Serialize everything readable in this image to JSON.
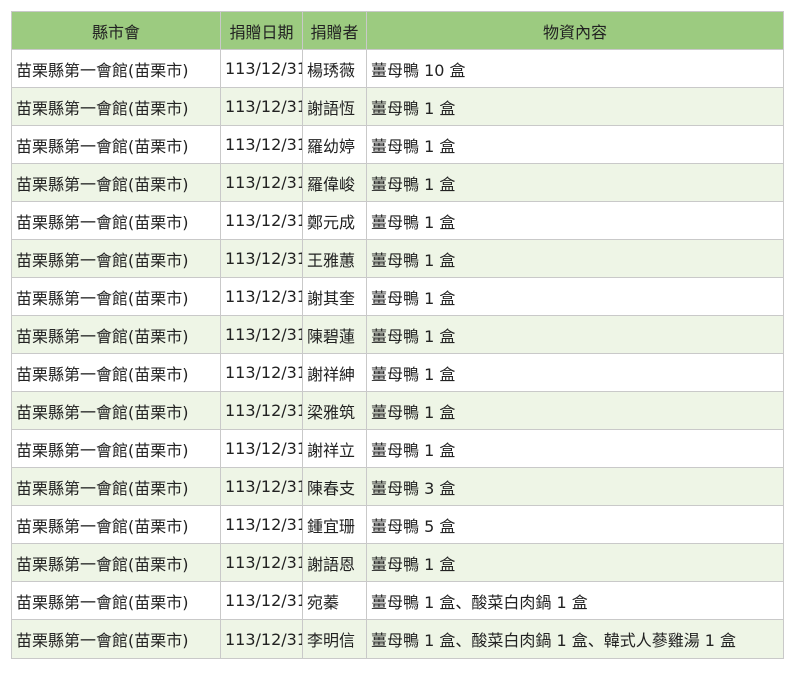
{
  "table": {
    "headers": [
      "縣市會",
      "捐贈日期",
      "捐贈者",
      "物資內容"
    ],
    "rows": [
      [
        "苗栗縣第一會館(苗栗市)",
        "113/12/31",
        "楊琇薇",
        "薑母鴨 10 盒"
      ],
      [
        "苗栗縣第一會館(苗栗市)",
        "113/12/31",
        "謝語恆",
        "薑母鴨 1 盒"
      ],
      [
        "苗栗縣第一會館(苗栗市)",
        "113/12/31",
        "羅幼婷",
        "薑母鴨 1 盒"
      ],
      [
        "苗栗縣第一會館(苗栗市)",
        "113/12/31",
        "羅偉峻",
        "薑母鴨 1 盒"
      ],
      [
        "苗栗縣第一會館(苗栗市)",
        "113/12/31",
        "鄭元成",
        "薑母鴨 1 盒"
      ],
      [
        "苗栗縣第一會館(苗栗市)",
        "113/12/31",
        "王雅蕙",
        "薑母鴨 1 盒"
      ],
      [
        "苗栗縣第一會館(苗栗市)",
        "113/12/31",
        "謝其奎",
        "薑母鴨 1 盒"
      ],
      [
        "苗栗縣第一會館(苗栗市)",
        "113/12/31",
        "陳碧蓮",
        "薑母鴨 1 盒"
      ],
      [
        "苗栗縣第一會館(苗栗市)",
        "113/12/31",
        "謝祥紳",
        "薑母鴨 1 盒"
      ],
      [
        "苗栗縣第一會館(苗栗市)",
        "113/12/31",
        "梁雅筑",
        "薑母鴨 1 盒"
      ],
      [
        "苗栗縣第一會館(苗栗市)",
        "113/12/31",
        "謝祥立",
        "薑母鴨 1 盒"
      ],
      [
        "苗栗縣第一會館(苗栗市)",
        "113/12/31",
        "陳春支",
        "薑母鴨 3 盒"
      ],
      [
        "苗栗縣第一會館(苗栗市)",
        "113/12/31",
        "鍾宜珊",
        "薑母鴨 5 盒"
      ],
      [
        "苗栗縣第一會館(苗栗市)",
        "113/12/31",
        "謝語恩",
        "薑母鴨 1 盒"
      ],
      [
        "苗栗縣第一會館(苗栗市)",
        "113/12/31",
        "宛蓁",
        "薑母鴨 1 盒、酸菜白肉鍋 1 盒"
      ],
      [
        "苗栗縣第一會館(苗栗市)",
        "113/12/31",
        "李明信",
        "薑母鴨 1 盒、酸菜白肉鍋 1 盒、韓式人蔘雞湯 1 盒"
      ]
    ]
  },
  "colors": {
    "header_bg": "#9ccb80",
    "row_alt_bg": "#eef5e6",
    "border": "#c9c9c9"
  }
}
